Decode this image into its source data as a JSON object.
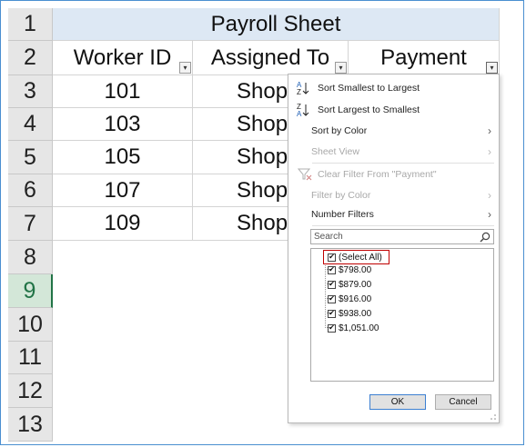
{
  "sheet": {
    "title": "Payroll Sheet",
    "row_numbers": [
      "1",
      "2",
      "3",
      "4",
      "5",
      "6",
      "7",
      "8",
      "9",
      "10",
      "11",
      "12",
      "13"
    ],
    "headers": {
      "worker_id": "Worker ID",
      "assigned_to": "Assigned To",
      "payment": "Payment"
    },
    "rows": [
      {
        "id": "101",
        "assigned": "Shop"
      },
      {
        "id": "103",
        "assigned": "Shop"
      },
      {
        "id": "105",
        "assigned": "Shop"
      },
      {
        "id": "107",
        "assigned": "Shop"
      },
      {
        "id": "109",
        "assigned": "Shop"
      }
    ],
    "filter_arrow": "▾",
    "active_row": "9"
  },
  "menu": {
    "sort_asc": "Sort Smallest to Largest",
    "sort_desc": "Sort Largest to Smallest",
    "sort_by_color": "Sort by Color",
    "sheet_view": "Sheet View",
    "clear_filter": "Clear Filter From \"Payment\"",
    "filter_by_color": "Filter by Color",
    "number_filters": "Number Filters",
    "search_placeholder": "Search",
    "chevron": "›",
    "items": [
      "(Select All)",
      "$798.00",
      "$879.00",
      "$916.00",
      "$938.00",
      "$1,051.00"
    ],
    "check": "✔",
    "ok": "OK",
    "cancel": "Cancel"
  },
  "colors": {
    "accent_border": "#4a8fd0",
    "title_fill": "#dde8f4",
    "select_all_highlight": "#c00000",
    "active_row": "#217346"
  },
  "icons": [
    "sort-ascending-icon",
    "sort-descending-icon",
    "clear-filter-icon",
    "search-icon",
    "chevron-right-icon",
    "filter-dropdown-icon",
    "resize-grip-icon"
  ]
}
